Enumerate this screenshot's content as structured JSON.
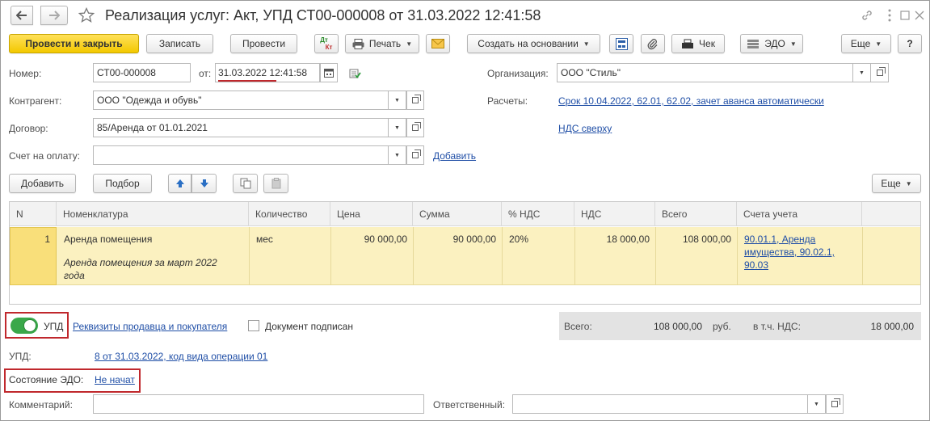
{
  "window": {
    "title": "Реализация услуг: Акт, УПД СТ00-000008 от 31.03.2022 12:41:58"
  },
  "toolbar": {
    "post_close": "Провести и закрыть",
    "write": "Записать",
    "post": "Провести",
    "dtkt_top": "Дт",
    "dtkt_bottom": "Кт",
    "print": "Печать",
    "create_based": "Создать на основании",
    "check": "Чек",
    "edo": "ЭДО",
    "more": "Еще",
    "help": "?"
  },
  "form": {
    "number_label": "Номер:",
    "number_value": "СТ00-000008",
    "from_label": "от:",
    "date_value": "31.03.2022 12:41:58",
    "org_label": "Организация:",
    "org_value": "ООО \"Стиль\"",
    "contractor_label": "Контрагент:",
    "contractor_value": "ООО \"Одежда и обувь\"",
    "settlements_label": "Расчеты:",
    "settlements_link": "Срок 10.04.2022, 62.01, 62.02, зачет аванса автоматически",
    "contract_label": "Договор:",
    "contract_value": "85/Аренда от 01.01.2021",
    "vat_link": "НДС сверху",
    "invoice_label": "Счет на оплату:",
    "invoice_value": "",
    "invoice_add": "Добавить"
  },
  "table_toolbar": {
    "add": "Добавить",
    "select": "Подбор",
    "more": "Еще"
  },
  "table": {
    "columns": [
      "N",
      "Номенклатура",
      "Количество",
      "Цена",
      "Сумма",
      "% НДС",
      "НДС",
      "Всего",
      "Счета учета"
    ],
    "rows": [
      {
        "n": "1",
        "item": "Аренда помещения",
        "item_desc_line1": "Аренда помещения за март 2022",
        "item_desc_line2": "года",
        "unit": "мес",
        "price": "90 000,00",
        "sum": "90 000,00",
        "vat_rate": "20%",
        "vat": "18 000,00",
        "total": "108 000,00",
        "accounts_line1": "90.01.1, Аренда",
        "accounts_line2": "имущества, 90.02.1,",
        "accounts_line3": "90.03"
      }
    ]
  },
  "bottom": {
    "upd_toggle_label": "УПД",
    "upd_toggle_on": true,
    "requisites_link": "Реквизиты продавца и покупателя",
    "signed_label": "Документ подписан",
    "signed_checked": false,
    "total_label": "Всего:",
    "total_value": "108 000,00",
    "currency": "руб.",
    "vat_label": "в т.ч. НДС:",
    "vat_value": "18 000,00",
    "upd_label": "УПД:",
    "upd_link": "8 от 31.03.2022, код вида операции 01",
    "edo_state_label": "Состояние ЭДО:",
    "edo_state_link": "Не начат",
    "comment_label": "Комментарий:",
    "comment_value": "",
    "responsible_label": "Ответственный:",
    "responsible_value": ""
  },
  "colors": {
    "accent_yellow": "#f3c800",
    "row_highlight": "#fbf1c0",
    "link": "#1f4ea6",
    "toggle_green": "#3aa84a",
    "red_annotation": "#c0282d"
  }
}
